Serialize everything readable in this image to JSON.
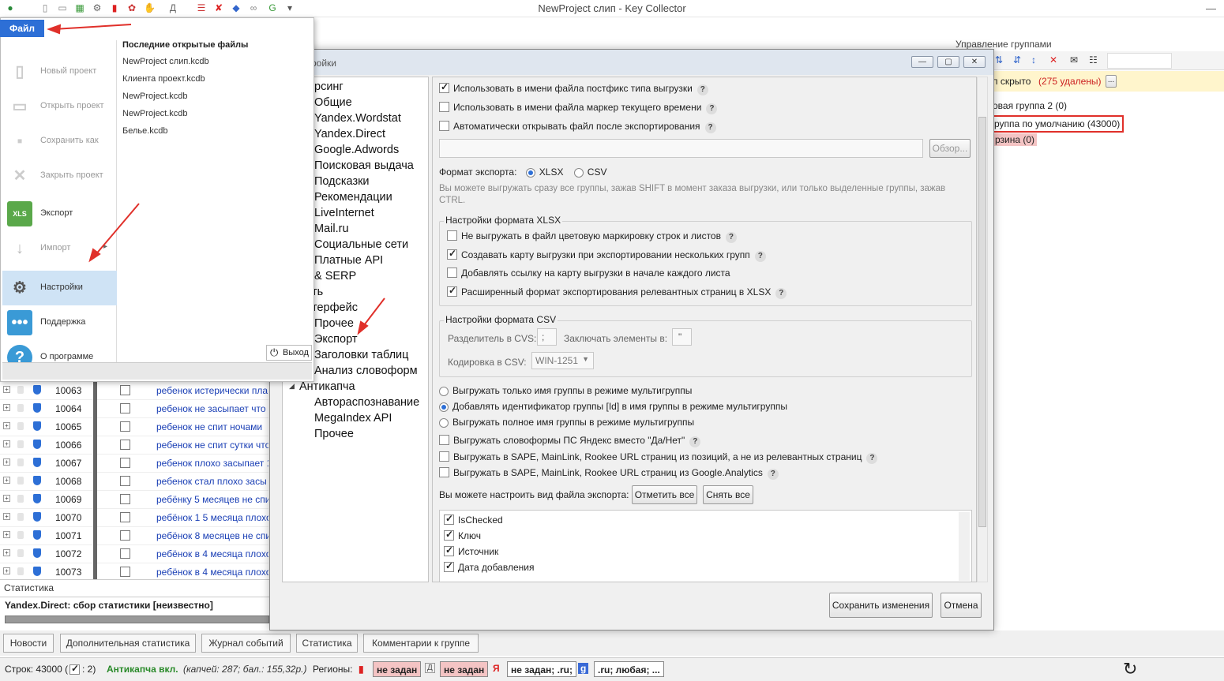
{
  "window": {
    "title": "NewProject слип - Key Collector"
  },
  "file_menu": {
    "file_tab": "Файл",
    "items": [
      {
        "label": "Новый проект",
        "icon": "new-doc-icon",
        "disabled": true
      },
      {
        "label": "Открыть проект",
        "icon": "folder-icon",
        "disabled": true
      },
      {
        "label": "Сохранить как",
        "icon": "floppy-icon",
        "disabled": true
      },
      {
        "label": "Закрыть проект",
        "icon": "close-icon",
        "disabled": true
      },
      {
        "label": "Экспорт",
        "icon": "xls-icon",
        "disabled": false
      },
      {
        "label": "Импорт",
        "icon": "import-arrow-icon",
        "disabled": true
      },
      {
        "label": "Настройки",
        "icon": "gear-icon",
        "disabled": false
      },
      {
        "label": "Поддержка",
        "icon": "chat-icon",
        "disabled": false
      },
      {
        "label": "О программе",
        "icon": "help-icon",
        "disabled": false
      }
    ],
    "recent_title": "Последние открытые файлы",
    "recent": [
      "NewProject слип.kcdb",
      "Клиента проект.kcdb",
      "NewProject.kcdb",
      "NewProject.kcdb",
      "Белье.kcdb"
    ],
    "exit": "Выход"
  },
  "background": {
    "rows": [
      {
        "id": "10063",
        "kw": "ребенок истерически пла"
      },
      {
        "id": "10064",
        "kw": "ребенок не засыпает что"
      },
      {
        "id": "10065",
        "kw": "ребенок не спит ночами"
      },
      {
        "id": "10066",
        "kw": "ребенок не спит сутки что"
      },
      {
        "id": "10067",
        "kw": "ребенок плохо засыпает 1"
      },
      {
        "id": "10068",
        "kw": "ребенок стал плохо засы"
      },
      {
        "id": "10069",
        "kw": "ребёнку 5 месяцев не спи"
      },
      {
        "id": "10070",
        "kw": "ребёнок 1 5 месяца плохо"
      },
      {
        "id": "10071",
        "kw": "ребёнок 8 месяцев не спи"
      },
      {
        "id": "10072",
        "kw": "ребёнок в 4 месяца плохо"
      },
      {
        "id": "10073",
        "kw": "ребёнок в 4 месяца плохо"
      }
    ],
    "groups_title": "Управление группами",
    "hidden_text": "п скрыто",
    "hidden_removed": "(275 удалены)",
    "group1": "овая группа 2 (0)",
    "group2": "руппа по умолчанию (43000)",
    "group3": "рзина (0)"
  },
  "dialog": {
    "title": "ройки",
    "tree": [
      {
        "label": "рсинг",
        "indent": 0
      },
      {
        "label": "Общие",
        "indent": 0
      },
      {
        "label": "Yandex.Wordstat",
        "indent": 0
      },
      {
        "label": "Yandex.Direct",
        "indent": 0
      },
      {
        "label": "Google.Adwords",
        "indent": 0
      },
      {
        "label": "Поисковая выдача",
        "indent": 0
      },
      {
        "label": "Подсказки",
        "indent": 0
      },
      {
        "label": "Рекомендации",
        "indent": 0
      },
      {
        "label": "LiveInternet",
        "indent": 0
      },
      {
        "label": "Mail.ru",
        "indent": 0
      },
      {
        "label": "Социальные сети",
        "indent": 0
      },
      {
        "label": "Платные API",
        "indent": 0
      },
      {
        "label": " & SERP",
        "indent": 0
      },
      {
        "label": "ть",
        "indent": -1
      },
      {
        "label": "терфейс",
        "indent": -1
      },
      {
        "label": "Прочее",
        "indent": 0
      },
      {
        "label": "Экспорт",
        "indent": 0
      },
      {
        "label": "Заголовки таблиц",
        "indent": 0
      },
      {
        "label": "Анализ словоформ",
        "indent": 0
      },
      {
        "label": "Антикапча",
        "indent": -2
      },
      {
        "label": "Автораспознавание",
        "indent": 0
      },
      {
        "label": "MegaIndex API",
        "indent": 0
      },
      {
        "label": "Прочее",
        "indent": 0
      }
    ],
    "opt_postfix": "Использовать в имени файла постфикс типа выгрузки",
    "opt_time": "Использовать в имени файла маркер текущего времени",
    "opt_autoopen": "Автоматически открывать файл после экспортирования",
    "browse": "Обзор...",
    "format_label": "Формат экспорта:",
    "fmt_xlsx": "XLSX",
    "fmt_csv": "CSV",
    "hint": "Вы можете выгружать сразу все группы, зажав SHIFT в момент заказа выгрузки, или только выделенные группы, зажав CTRL.",
    "xlsx_group": "Настройки формата XLSX",
    "xlsx_opt1": "Не выгружать в файл цветовую маркировку строк и листов",
    "xlsx_opt2": "Создавать карту выгрузки при экспортировании нескольких групп",
    "xlsx_opt3": "Добавлять ссылку на карту выгрузки в начале каждого листа",
    "xlsx_opt4": "Расширенный формат экспортирования релевантных страниц в XLSX",
    "csv_group": "Настройки формата CSV",
    "csv_sep_label": "Разделитель в CVS:",
    "csv_sep": ";",
    "csv_encl_label": "Заключать элементы в:",
    "csv_encl": "\"",
    "csv_enc_label": "Кодировка в CSV:",
    "csv_enc": "WIN-1251",
    "radio1": "Выгружать только имя группы в режиме мультигруппы",
    "radio2": "Добавлять идентификатор группы [Id] в имя группы в режиме мультигруппы",
    "radio3": "Выгружать полное имя группы в режиме мультигруппы",
    "opt_wordforms": "Выгружать словоформы ПС Яндекс вместо \"Да/Нет\"",
    "opt_sape1": "Выгружать в SAPE, MainLink, Rookee URL страниц из позиций, а не из релевантных страниц",
    "opt_sape2": "Выгружать в SAPE, MainLink, Rookee URL страниц из Google.Analytics",
    "view_label": "Вы можете настроить вид файла экспорта:",
    "mark_all": "Отметить все",
    "unmark_all": "Снять все",
    "columns": [
      "IsChecked",
      "Ключ",
      "Источник",
      "Дата добавления"
    ],
    "save": "Сохранить изменения",
    "cancel": "Отмена"
  },
  "bottom": {
    "stat_title": "Статистика",
    "stat_text": "Yandex.Direct: сбор статистики [неизвестно]",
    "tabs": [
      "Новости",
      "Дополнительная статистика",
      "Журнал событий",
      "Статистика",
      "Комментарии к группе"
    ],
    "rows_label": "Строк: 43000 (",
    "rows_checked": ": 2)",
    "anticaptcha": "Антикапча вкл.",
    "anticaptcha_info": "(капчей: 287; бал.: 155,32р.)",
    "regions_label": "Регионы:",
    "reg1": "не задан",
    "reg2": "не задан",
    "reg3": "не задан; .ru;",
    "reg4": ".ru; любая; ..."
  },
  "colors": {
    "accent": "#2d6fd6",
    "red": "#e0302a",
    "pink": "#f4c4c4"
  }
}
